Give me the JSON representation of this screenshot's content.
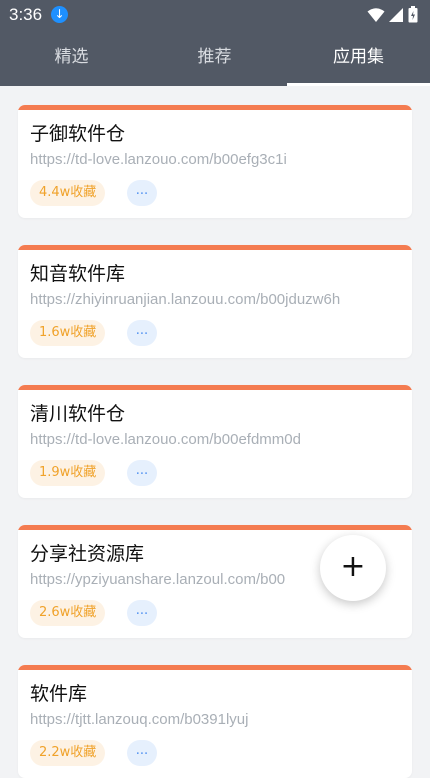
{
  "status_bar": {
    "time": "3:36",
    "icons": [
      "download-icon",
      "wifi-icon",
      "signal-icon",
      "battery-icon"
    ]
  },
  "tabs": [
    {
      "label": "精选",
      "active": false
    },
    {
      "label": "推荐",
      "active": false
    },
    {
      "label": "应用集",
      "active": true
    }
  ],
  "cards": [
    {
      "title": "子御软件仓",
      "url": "https://td-love.lanzouo.com/b00efg3c1i",
      "favorites": "4.4w收藏",
      "more": "..."
    },
    {
      "title": "知音软件库",
      "url": "https://zhiyinruanjian.lanzouu.com/b00jduzw6h",
      "favorites": "1.6w收藏",
      "more": "..."
    },
    {
      "title": "清川软件仓",
      "url": "https://td-love.lanzouo.com/b00efdmm0d",
      "favorites": "1.9w收藏",
      "more": "..."
    },
    {
      "title": "分享社资源库",
      "url": "https://ypziyuanshare.lanzoul.com/b00",
      "favorites": "2.6w收藏",
      "more": "..."
    },
    {
      "title": "软件库",
      "url": "https://tjtt.lanzouq.com/b0391lyuj",
      "favorites": "2.2w收藏",
      "more": "..."
    }
  ],
  "fab": {
    "label": "+"
  },
  "colors": {
    "header_bg": "#525965",
    "card_accent": "#f47b50",
    "badge_fav_text": "#f0a22a",
    "badge_more_text": "#4b8ef0"
  }
}
